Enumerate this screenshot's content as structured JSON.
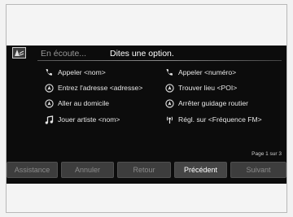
{
  "header": {
    "listening_text": "En écoute...",
    "prompt_text": "Dites une option."
  },
  "commands": {
    "left": [
      {
        "label": "Appeler <nom>",
        "icon": "phone-icon"
      },
      {
        "label": "Entrez l'adresse <adresse>",
        "icon": "navigation-icon"
      },
      {
        "label": "Aller au domicile",
        "icon": "navigation-icon"
      },
      {
        "label": "Jouer artiste <nom>",
        "icon": "music-note-icon"
      }
    ],
    "right": [
      {
        "label": "Appeler <numéro>",
        "icon": "phone-icon"
      },
      {
        "label": "Trouver lieu <POI>",
        "icon": "navigation-icon"
      },
      {
        "label": "Arrêter guidage routier",
        "icon": "navigation-icon"
      },
      {
        "label": "Régl. sur <Fréquence FM>",
        "icon": "radio-icon"
      }
    ]
  },
  "pagination": {
    "text": "Page 1 sur 3"
  },
  "buttons": {
    "assistance": "Assistance",
    "cancel": "Annuler",
    "back": "Retour",
    "previous": "Précédent",
    "next": "Suivant"
  },
  "colors": {
    "screen_bg": "#0c0c0c",
    "button_bg": "#3d3d3d",
    "text_active": "#ffffff",
    "text_dim": "#8a8a8a"
  }
}
